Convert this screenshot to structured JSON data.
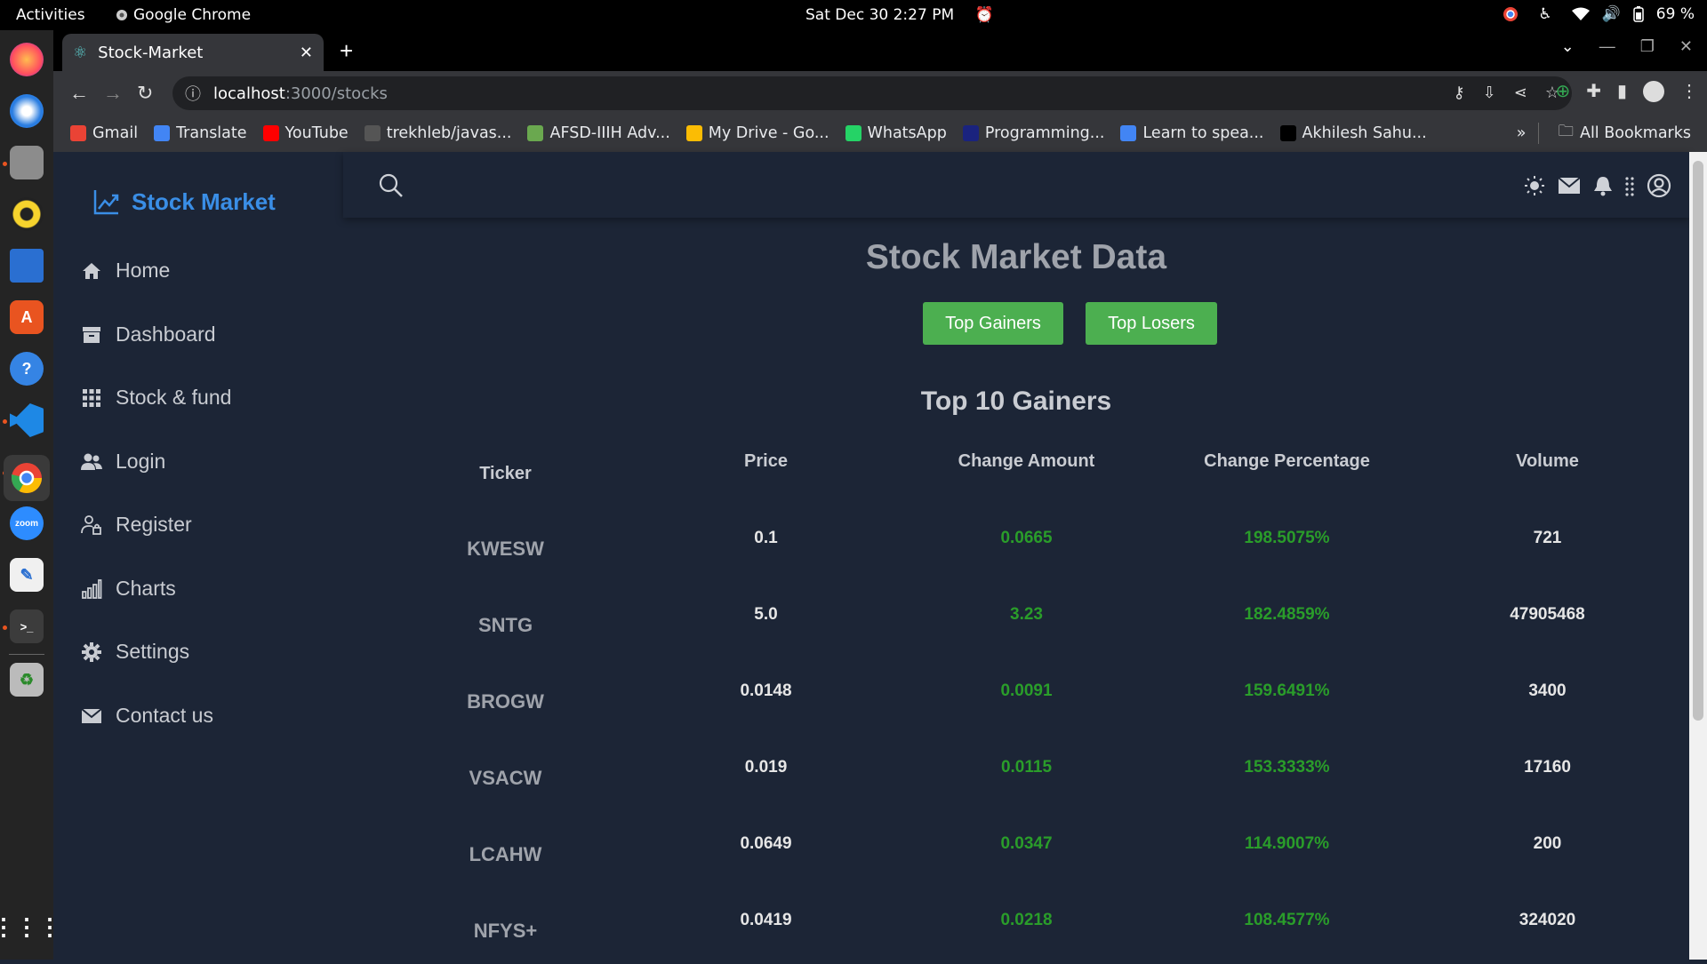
{
  "system": {
    "activities": "Activities",
    "app_name": "Google Chrome",
    "clock": "Sat Dec 30  2:27 PM",
    "battery": "69 %"
  },
  "browser": {
    "tab_title": "Stock-Market",
    "url_host": "localhost",
    "url_path": ":3000/stocks",
    "bookmarks": [
      {
        "label": "Gmail",
        "color": "#ea4335"
      },
      {
        "label": "Translate",
        "color": "#4285f4"
      },
      {
        "label": "YouTube",
        "color": "#ff0000"
      },
      {
        "label": "trekhleb/javas...",
        "color": "#555555"
      },
      {
        "label": "AFSD-IIIH Adv...",
        "color": "#6aa84f"
      },
      {
        "label": "My Drive - Go...",
        "color": "#fbbc04"
      },
      {
        "label": "WhatsApp",
        "color": "#25d366"
      },
      {
        "label": "Programming...",
        "color": "#1a237e"
      },
      {
        "label": "Learn to spea...",
        "color": "#4285f4"
      },
      {
        "label": "Akhilesh Sahu...",
        "color": "#000000"
      }
    ],
    "all_bookmarks": "All Bookmarks"
  },
  "app": {
    "brand": "Stock Market",
    "nav": [
      {
        "label": "Home",
        "icon": "home-icon"
      },
      {
        "label": "Dashboard",
        "icon": "archive-icon"
      },
      {
        "label": "Stock & fund",
        "icon": "grid-icon"
      },
      {
        "label": "Login",
        "icon": "users-icon"
      },
      {
        "label": "Register",
        "icon": "user-lock-icon"
      },
      {
        "label": "Charts",
        "icon": "bar-chart-icon"
      },
      {
        "label": "Settings",
        "icon": "gear-icon"
      },
      {
        "label": "Contact us",
        "icon": "envelope-icon"
      }
    ],
    "title": "Stock Market Data",
    "buttons": {
      "gainers": "Top Gainers",
      "losers": "Top Losers"
    },
    "subtitle": "Top 10 Gainers",
    "columns": [
      "Ticker",
      "Price",
      "Change Amount",
      "Change Percentage",
      "Volume"
    ],
    "rows": [
      [
        "KWESW",
        "0.1",
        "0.0665",
        "198.5075%",
        "721"
      ],
      [
        "SNTG",
        "5.0",
        "3.23",
        "182.4859%",
        "47905468"
      ],
      [
        "BROGW",
        "0.0148",
        "0.0091",
        "159.6491%",
        "3400"
      ],
      [
        "VSACW",
        "0.019",
        "0.0115",
        "153.3333%",
        "17160"
      ],
      [
        "LCAHW",
        "0.0649",
        "0.0347",
        "114.9007%",
        "200"
      ],
      [
        "NFYS+",
        "0.0419",
        "0.0218",
        "108.4577%",
        "324020"
      ]
    ],
    "colors": {
      "accent": "#3a8ee6",
      "button": "#4caf50",
      "positive": "#2a9d2a",
      "background": "#1c2536"
    }
  }
}
